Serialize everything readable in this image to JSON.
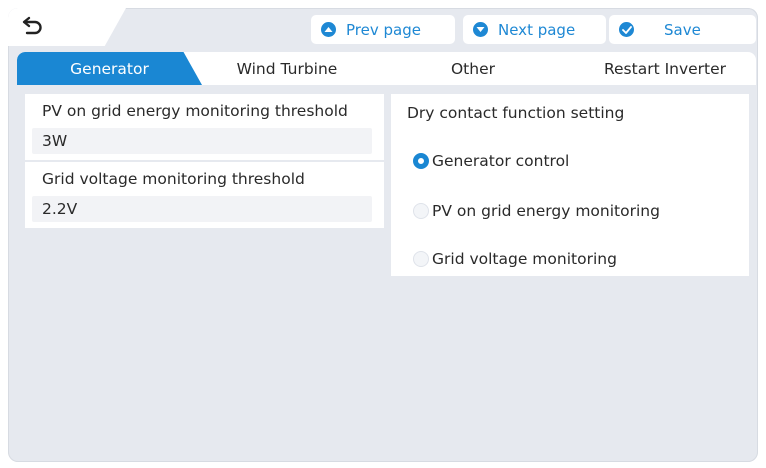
{
  "toolbar": {
    "back_icon": "back-arrow-icon",
    "prev_label": "Prev page",
    "prev_icon": "chevron-up-circle-icon",
    "next_label": "Next page",
    "next_icon": "chevron-down-circle-icon",
    "save_label": "Save",
    "save_icon": "check-circle-icon",
    "accent_color": "#1e88d4"
  },
  "tabs": [
    {
      "label": "Generator",
      "active": true
    },
    {
      "label": "Wind Turbine",
      "active": false
    },
    {
      "label": "Other",
      "active": false
    },
    {
      "label": "Restart Inverter",
      "active": false
    }
  ],
  "left_panel": {
    "pv_threshold": {
      "label": "PV on grid energy monitoring threshold",
      "value": "3W"
    },
    "grid_threshold": {
      "label": "Grid voltage monitoring threshold",
      "value": "2.2V"
    }
  },
  "dry_contact": {
    "title": "Dry contact function setting",
    "options": [
      {
        "label": "Generator control",
        "selected": true
      },
      {
        "label": "PV on grid energy monitoring",
        "selected": false
      },
      {
        "label": "Grid voltage monitoring",
        "selected": false
      }
    ]
  }
}
